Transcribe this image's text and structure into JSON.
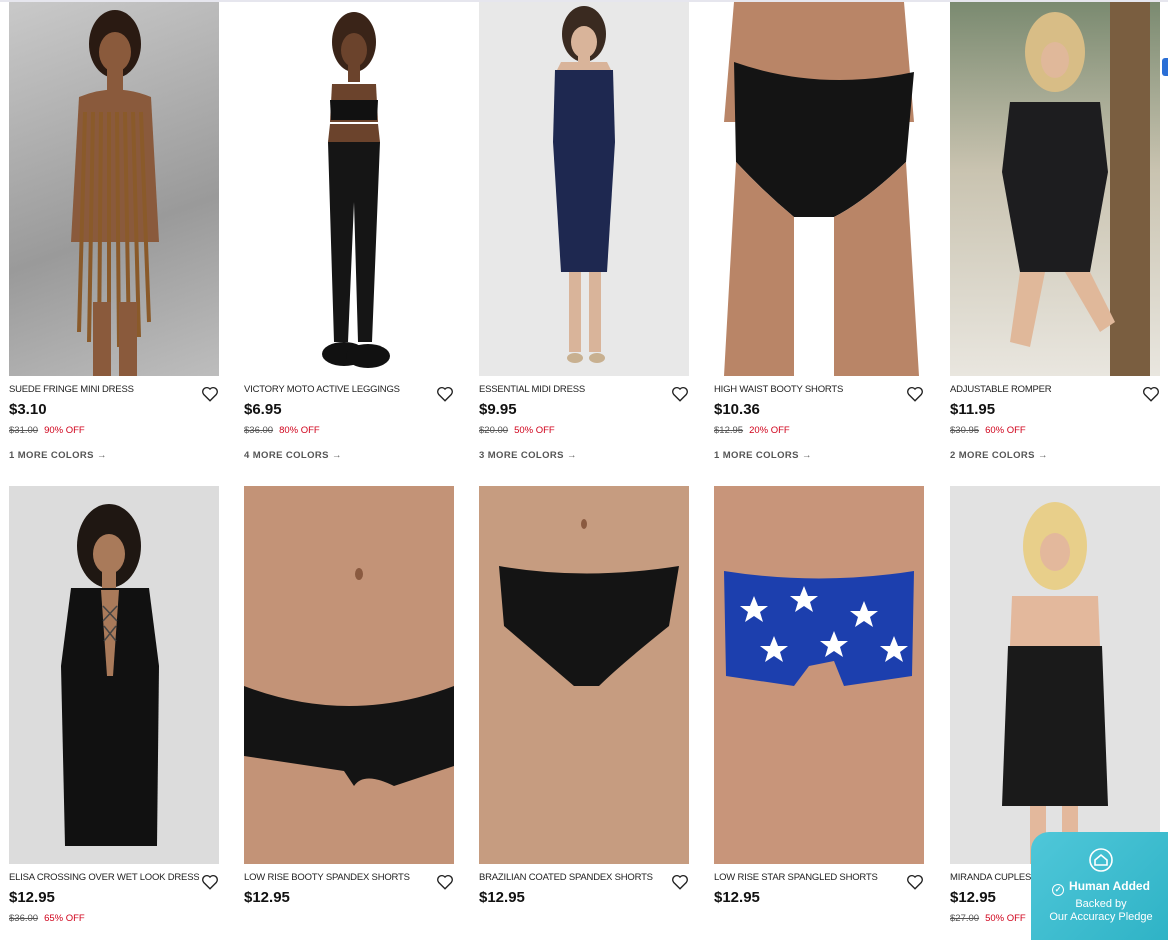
{
  "products_row1": [
    {
      "name": "SUEDE FRINGE MINI DRESS",
      "price": "$3.10",
      "original": "$31.00",
      "discount": "90% OFF",
      "more_colors": "1 MORE COLORS →"
    },
    {
      "name": "VICTORY MOTO ACTIVE LEGGINGS",
      "price": "$6.95",
      "original": "$36.00",
      "discount": "80% OFF",
      "more_colors": "4 MORE COLORS →"
    },
    {
      "name": "ESSENTIAL MIDI DRESS",
      "price": "$9.95",
      "original": "$20.00",
      "discount": "50% OFF",
      "more_colors": "3 MORE COLORS →"
    },
    {
      "name": "HIGH WAIST BOOTY SHORTS",
      "price": "$10.36",
      "original": "$12.95",
      "discount": "20% OFF",
      "more_colors": "1 MORE COLORS →"
    },
    {
      "name": "ADJUSTABLE ROMPER",
      "price": "$11.95",
      "original": "$30.95",
      "discount": "60% OFF",
      "more_colors": "2 MORE COLORS →"
    }
  ],
  "products_row2": [
    {
      "name": "ELISA CROSSING OVER WET LOOK DRESS",
      "price": "$12.95",
      "original": "$36.00",
      "discount": "65% OFF"
    },
    {
      "name": "LOW RISE BOOTY SPANDEX SHORTS",
      "price": "$12.95"
    },
    {
      "name": "BRAZILIAN COATED SPANDEX SHORTS",
      "price": "$12.95"
    },
    {
      "name": "LOW RISE STAR SPANGLED SHORTS",
      "price": "$12.95"
    },
    {
      "name": "MIRANDA CUPLESS WET LOOK DRESS",
      "price": "$12.95",
      "original": "$27.00",
      "discount": "50% OFF"
    }
  ],
  "badge": {
    "title": "Human Added",
    "line1": "Backed by",
    "line2": "Our Accuracy Pledge"
  },
  "icons": {
    "wishlist": "heart-outline-icon",
    "badge": "house-shield-icon"
  },
  "colors": {
    "discount_red": "#d0021b",
    "badge_teal": "#3dbdd0"
  }
}
